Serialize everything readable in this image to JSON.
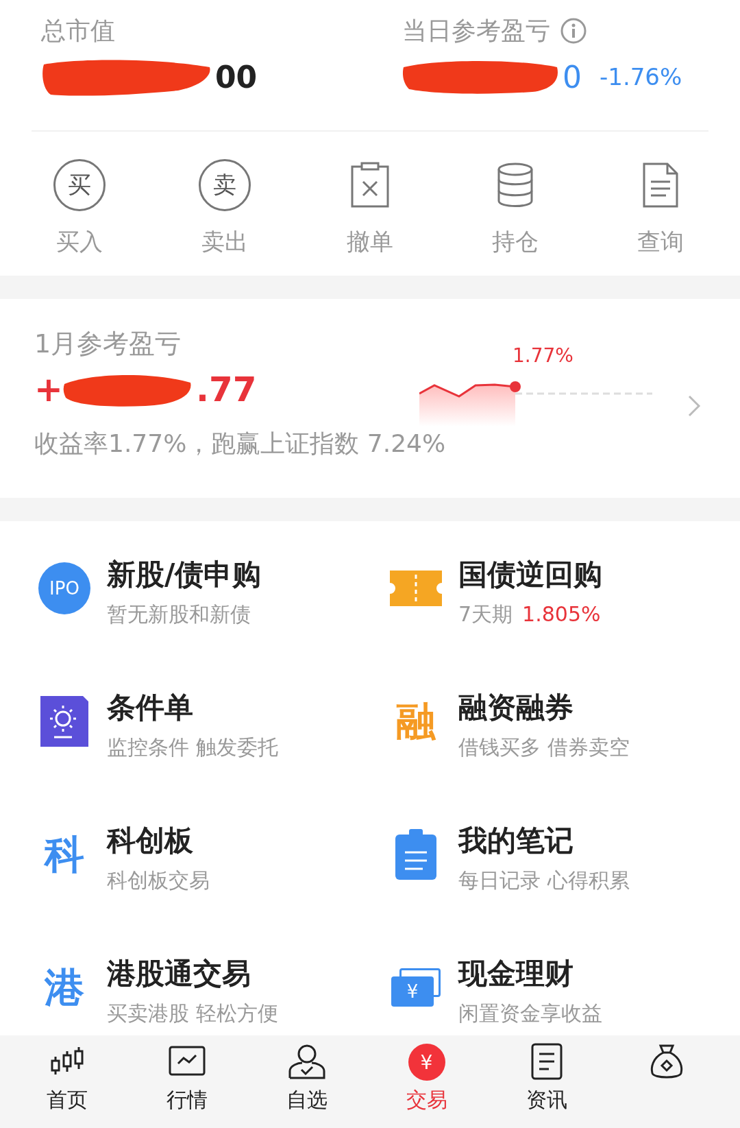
{
  "summary": {
    "total": {
      "label": "总市值",
      "visible_value": "00"
    },
    "daily": {
      "label": "当日参考盈亏",
      "visible_value": "0",
      "percent": "-1.76%"
    }
  },
  "actions": [
    {
      "label": "买入",
      "kind": "circle",
      "glyph": "买"
    },
    {
      "label": "卖出",
      "kind": "circle",
      "glyph": "卖"
    },
    {
      "label": "撤单",
      "kind": "cancel"
    },
    {
      "label": "持仓",
      "kind": "stack"
    },
    {
      "label": "查询",
      "kind": "doc"
    }
  ],
  "monthly": {
    "title": "1月参考盈亏",
    "sign": "+",
    "visible_value": ".77",
    "chart_label": "1.77%",
    "note": "收益率1.77%，跑赢上证指数 7.24%"
  },
  "features": [
    {
      "title": "新股/债申购",
      "subtitle": "暂无新股和新债",
      "kind": "badge",
      "glyph": "IPO"
    },
    {
      "title": "国债逆回购",
      "subtitle": "7天期",
      "rate": "1.805%",
      "kind": "ticket"
    },
    {
      "title": "条件单",
      "subtitle": "监控条件 触发委托",
      "kind": "sun-card"
    },
    {
      "title": "融资融券",
      "subtitle": "借钱买多 借券卖空",
      "kind": "glyph",
      "glyph": "融",
      "color": "#f59a23"
    },
    {
      "title": "科创板",
      "subtitle": "科创板交易",
      "kind": "glyph",
      "glyph": "科",
      "color": "#3d8ef0"
    },
    {
      "title": "我的笔记",
      "subtitle": "每日记录 心得积累",
      "kind": "clipboard"
    },
    {
      "title": "港股通交易",
      "subtitle": "买卖港股 轻松方便",
      "kind": "glyph",
      "glyph": "港",
      "color": "#3d8ef0"
    },
    {
      "title": "现金理财",
      "subtitle": "闲置资金享收益",
      "kind": "cash-card",
      "glyph": "¥"
    }
  ],
  "nav": [
    {
      "label": "首页",
      "kind": "candles",
      "selected": false
    },
    {
      "label": "行情",
      "kind": "chart",
      "selected": false
    },
    {
      "label": "自选",
      "kind": "person",
      "selected": false
    },
    {
      "label": "交易",
      "kind": "yen",
      "glyph": "¥",
      "selected": true
    },
    {
      "label": "资讯",
      "kind": "news",
      "selected": false
    },
    {
      "kind": "bag",
      "selected": false
    }
  ]
}
